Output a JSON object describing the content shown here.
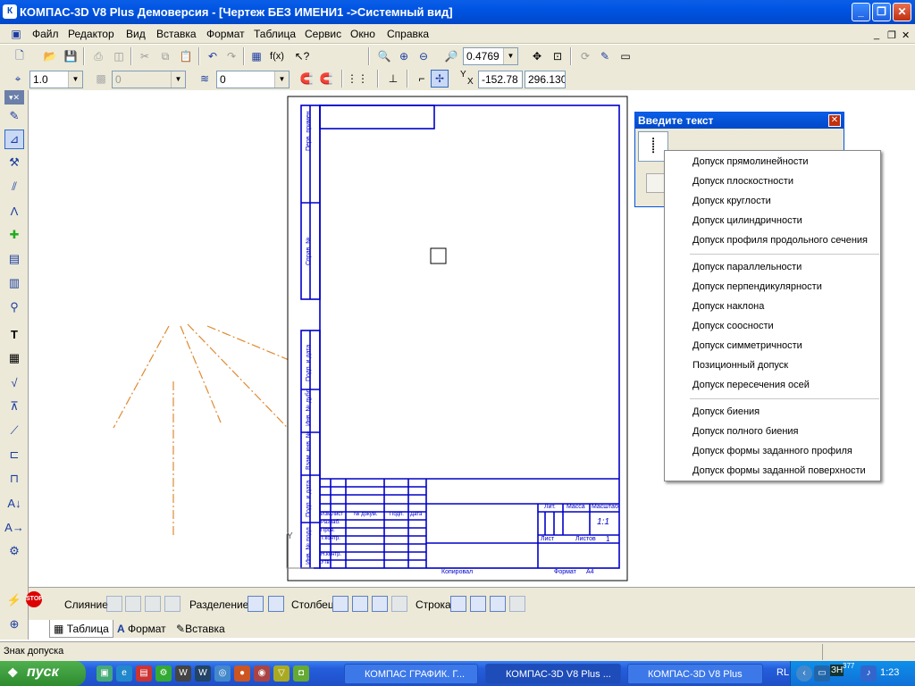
{
  "window": {
    "title": "КОМПАС-3D V8 Plus Демоверсия - [Чертеж БЕЗ ИМЕНИ1 ->Системный вид]"
  },
  "menu": [
    "Файл",
    "Редактор",
    "Вид",
    "Вставка",
    "Формат",
    "Таблица",
    "Сервис",
    "Окно",
    "Справка"
  ],
  "toolbar": {
    "zoom_value": "0.4769",
    "line_scale": "1.0",
    "style_value": "0",
    "layer_value": "0",
    "coord_x": "-152.78",
    "coord_y": "296.130",
    "coord_label_y": "Y",
    "coord_label_x": "X"
  },
  "dialog": {
    "title": "Введите текст"
  },
  "context_menu": {
    "group1": [
      "Допуск прямолинейности",
      "Допуск плоскостности",
      "Допуск круглости",
      "Допуск цилиндричности",
      "Допуск профиля продольного сечения"
    ],
    "group2": [
      "Допуск параллельности",
      "Допуск перпендикулярности",
      "Допуск наклона",
      "Допуск соосности",
      "Допуск симметричности",
      "Позиционный допуск",
      "Допуск пересечения осей"
    ],
    "group3": [
      "Допуск биения",
      "Допуск полного биения",
      "Допуск формы заданного профиля",
      "Допуск формы заданной поверхности"
    ]
  },
  "sheet": {
    "side_labels": [
      "Перв. примен.",
      "Справ. №",
      "Подп. и дата",
      "Инв. № дубл.",
      "Взам. инв. №",
      "Подп. и дата",
      "Инв. № подл."
    ],
    "stamp_cols": [
      "Изм.",
      "Лист",
      "№ докум.",
      "Подп.",
      "Дата"
    ],
    "stamp_rows": [
      "Разраб.",
      "Пров.",
      "Т.контр.",
      "Н.контр.",
      "Утв."
    ],
    "lit": "Лит.",
    "mass": "Масса",
    "scale": "Масштаб",
    "scale_value": "1:1",
    "sheet_label": "Лист",
    "sheets_label": "Листов",
    "sheets_value": "1",
    "copied": "Копировал",
    "format": "Формат",
    "format_value": "A4",
    "axis_y": "Y"
  },
  "properties": {
    "merge_label": "Слияние",
    "split_label": "Разделение",
    "column_label": "Столбец",
    "row_label": "Строка"
  },
  "tabs": [
    "Таблица",
    "Формат",
    "Вставка"
  ],
  "status_text": "Знак допуска",
  "taskbar": {
    "start": "пуск",
    "tasks": [
      "КОМПАС ГРАФИК. Г...",
      "КОМПАС-3D V8 Plus ...",
      "КОМПАС-3D V8  Plus"
    ],
    "lang": "RL",
    "kb": "ЗН",
    "tray_num": "377",
    "clock": "1:23"
  },
  "colors": {
    "sheet_line": "#0000c8",
    "axis_dash": "#e08a30",
    "titlebar": "#0054e3"
  }
}
